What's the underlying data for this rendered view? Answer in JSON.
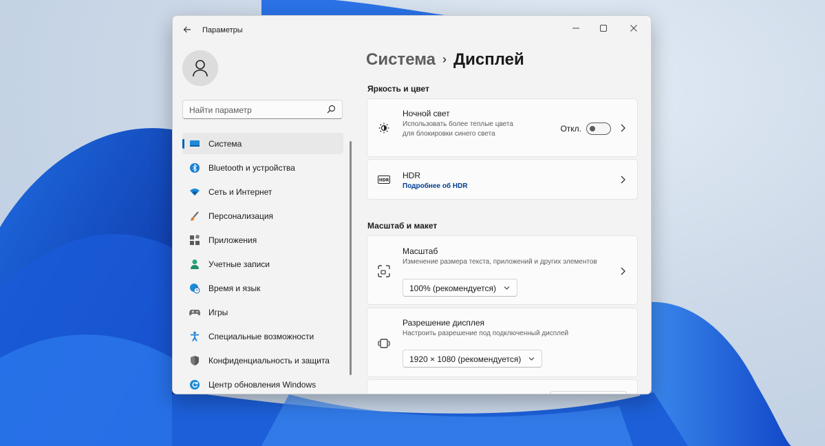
{
  "window": {
    "app_title": "Параметры",
    "back_icon": "arrow-left-icon",
    "controls": [
      "minimize-icon",
      "maximize-icon",
      "close-icon"
    ]
  },
  "sidebar": {
    "avatar_icon": "person-icon",
    "search": {
      "placeholder": "Найти параметр",
      "icon": "search-icon"
    },
    "items": [
      {
        "label": "Система",
        "icon": "monitor-icon",
        "active": true
      },
      {
        "label": "Bluetooth и устройства",
        "icon": "bluetooth-icon"
      },
      {
        "label": "Сеть и Интернет",
        "icon": "wifi-icon"
      },
      {
        "label": "Персонализация",
        "icon": "brush-icon"
      },
      {
        "label": "Приложения",
        "icon": "apps-icon"
      },
      {
        "label": "Учетные записи",
        "icon": "user-icon"
      },
      {
        "label": "Время и язык",
        "icon": "globe-clock-icon"
      },
      {
        "label": "Игры",
        "icon": "gamepad-icon"
      },
      {
        "label": "Специальные возможности",
        "icon": "accessibility-icon"
      },
      {
        "label": "Конфиденциальность и защита",
        "icon": "shield-icon"
      },
      {
        "label": "Центр обновления Windows",
        "icon": "update-icon"
      }
    ]
  },
  "main": {
    "breadcrumb": {
      "parent": "Система",
      "separator": "›",
      "current": "Дисплей"
    },
    "sections": {
      "brightness": {
        "title": "Яркость и цвет",
        "night_light": {
          "title": "Ночной свет",
          "description": "Использовать более теплые цвета для блокировки синего света",
          "toggle_label": "Откл.",
          "toggle_on": false,
          "icon": "brightness-icon"
        },
        "hdr": {
          "title": "HDR",
          "link": "Подробнее об HDR",
          "icon": "hdr-icon"
        }
      },
      "scale_layout": {
        "title": "Масштаб и макет",
        "scale": {
          "title": "Масштаб",
          "description": "Изменение размера текста, приложений и других элементов",
          "value": "100% (рекомендуется)",
          "icon": "scale-icon"
        },
        "resolution": {
          "title": "Разрешение дисплея",
          "description": "Настроить разрешение под подключенный дисплей",
          "value": "1920 × 1080 (рекомендуется)",
          "icon": "resolution-icon"
        }
      }
    }
  },
  "colors": {
    "accent": "#005fb8",
    "link": "#003e92",
    "window_bg": "#f3f3f3",
    "card_bg": "#fbfbfb"
  }
}
